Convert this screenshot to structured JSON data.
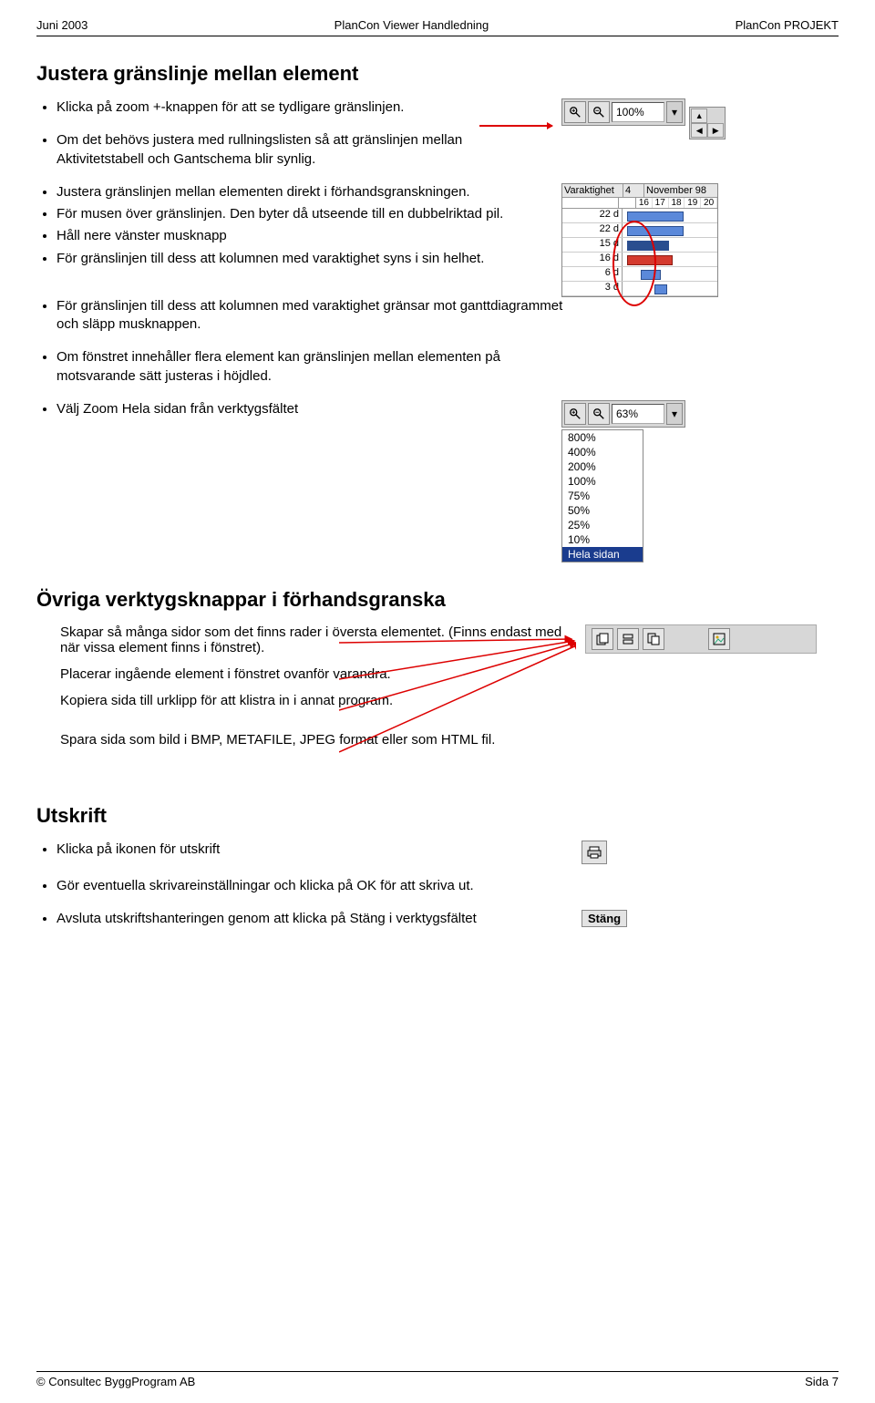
{
  "header": {
    "left": "Juni 2003",
    "center": "PlanCon Viewer Handledning",
    "right": "PlanCon PROJEKT"
  },
  "section1": {
    "title": "Justera gränslinje mellan element",
    "b1": "Klicka på zoom +-knappen för att se tydligare gränslinjen.",
    "b2": "Om det behövs justera med rullningslisten så att gränslinjen mellan Aktivitetstabell och Gantschema blir synlig.",
    "b3": "Justera gränslinjen mellan elementen direkt i förhandsgranskningen.",
    "b4": "För musen över gränslinjen. Den byter då utseende till en dubbelriktad pil.",
    "b5": "Håll nere vänster musknapp",
    "b6": "För gränslinjen till dess att kolumnen med varaktighet syns i sin helhet.",
    "b7": "För gränslinjen till dess att kolumnen med varaktighet gränsar mot ganttdiagrammet och släpp musknappen.",
    "b8": "Om fönstret innehåller flera element kan gränslinjen mellan elementen på motsvarande sätt justeras i höjdled.",
    "b9": "Välj Zoom Hela sidan från verktygsfältet"
  },
  "zoom1": {
    "value": "100%"
  },
  "gantt": {
    "col_activity": "Varaktighet",
    "col_qty": "4",
    "month": "November 98",
    "days": [
      "16",
      "17",
      "18",
      "19",
      "20"
    ],
    "rows": [
      "22 d",
      "22 d",
      "15 d",
      "16 d",
      "6 d",
      "3 d"
    ]
  },
  "zoom2": {
    "value": "63%",
    "options": [
      "800%",
      "400%",
      "200%",
      "100%",
      "75%",
      "50%",
      "25%",
      "10%",
      "Hela sidan"
    ],
    "selected": "Hela sidan"
  },
  "section2": {
    "title": "Övriga verktygsknappar i förhandsgranska",
    "p1": "Skapar så många sidor som det finns rader i översta elementet. (Finns endast med när vissa element finns i fönstret).",
    "p2": "Placerar ingående element i fönstret ovanför varandra.",
    "p3": "Kopiera sida till urklipp för att klistra in i annat program.",
    "p4": "Spara sida som bild i BMP, METAFILE, JPEG format eller som HTML fil."
  },
  "section3": {
    "title": "Utskrift",
    "b1": "Klicka på ikonen för utskrift",
    "b2": "Gör eventuella skrivareinställningar och klicka på OK för att skriva ut.",
    "b3": "Avsluta utskriftshanteringen genom att klicka på Stäng i verktygsfältet"
  },
  "close_label": "Stäng",
  "footer": {
    "left": "© Consultec ByggProgram AB",
    "right": "Sida 7"
  }
}
